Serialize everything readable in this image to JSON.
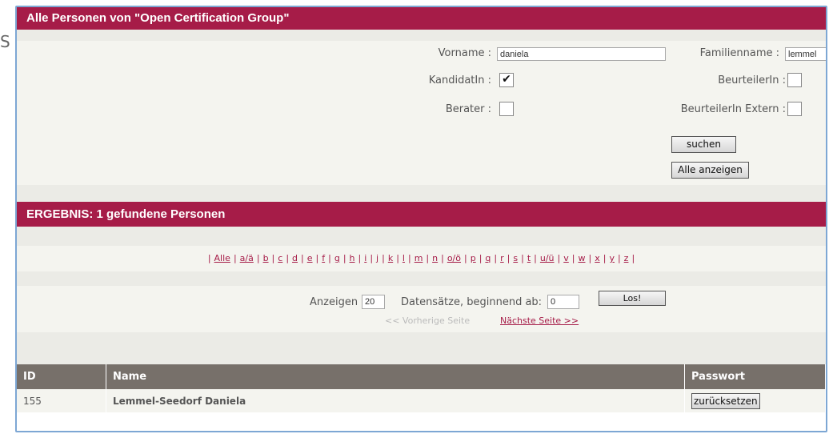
{
  "stray_text": "S",
  "panel_title": "Alle Personen von \"Open Certification Group\"",
  "search": {
    "vorname_label": "Vorname :",
    "vorname_value": "daniela",
    "familienname_label": "Familienname :",
    "familienname_value": "lemmel",
    "kandidat_label": "KandidatIn :",
    "kandidat_checked": "✔",
    "beurteiler_label": "BeurteilerIn :",
    "berater_label": "Berater :",
    "beurteiler_extern_label": "BeurteilerIn Extern :",
    "suchen_button": "suchen",
    "alle_anzeigen_button": "Alle anzeigen"
  },
  "result_title": "ERGEBNIS: 1 gefundene Personen",
  "alphabet": [
    "Alle",
    "a/ä",
    "b",
    "c",
    "d",
    "e",
    "f",
    "g",
    "h",
    "i",
    "j",
    "k",
    "l",
    "m",
    "n",
    "o/ö",
    "p",
    "q",
    "r",
    "s",
    "t",
    "u/ü",
    "v",
    "w",
    "x",
    "y",
    "z"
  ],
  "paging": {
    "anzeigen_label": "Anzeigen",
    "anzeigen_value": "20",
    "datensaetze_label": "Datensätze, beginnend ab:",
    "start_value": "0",
    "los_button": "Los!",
    "prev_label": "<< Vorherige Seite",
    "next_label": "Nächste Seite >>"
  },
  "table": {
    "headers": [
      "ID",
      "Name",
      "Passwort"
    ],
    "rows": [
      {
        "id": "155",
        "name": "Lemmel-Seedorf Daniela",
        "action": "zurücksetzen"
      }
    ]
  },
  "colors": {
    "header_bg": "#a61c48",
    "table_header_bg": "#77706a",
    "frame_border": "#7da7d4"
  }
}
